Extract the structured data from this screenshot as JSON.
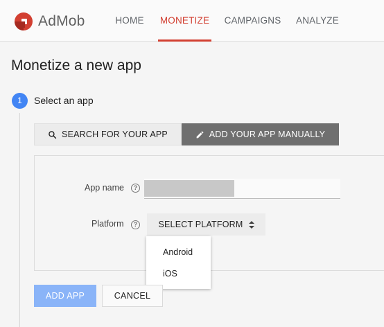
{
  "app": {
    "brand": "AdMob",
    "brand_color": "#d23f31"
  },
  "nav": {
    "tabs": [
      {
        "label": "HOME",
        "active": false
      },
      {
        "label": "MONETIZE",
        "active": true
      },
      {
        "label": "CAMPAIGNS",
        "active": false
      },
      {
        "label": "ANALYZE",
        "active": false
      }
    ]
  },
  "page": {
    "title": "Monetize a new app"
  },
  "step": {
    "number": "1",
    "label": "Select an app",
    "color": "#4285f4"
  },
  "mode_tabs": {
    "search": {
      "label": "SEARCH FOR YOUR APP",
      "icon": "search-icon",
      "selected": false
    },
    "manual": {
      "label": "ADD YOUR APP MANUALLY",
      "icon": "pencil-icon",
      "selected": true
    }
  },
  "form": {
    "app_name": {
      "label": "App name",
      "help_icon": "help-icon",
      "value": ""
    },
    "platform": {
      "label": "Platform",
      "help_icon": "help-icon",
      "select_label": "SELECT PLATFORM",
      "options": [
        "Android",
        "iOS"
      ],
      "dropdown_open": true
    }
  },
  "actions": {
    "add_label": "ADD APP",
    "add_enabled": false,
    "cancel_label": "CANCEL"
  }
}
